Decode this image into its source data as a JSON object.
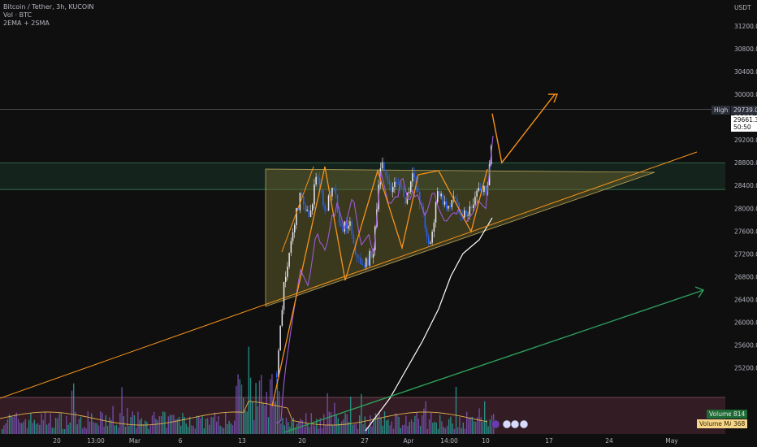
{
  "legend": {
    "symbol": "Bitcoin / Tether, 3h, KUCOIN",
    "volume": "Vol · BTC",
    "ma": "2EMA + 2SMA"
  },
  "price_axis": {
    "currency": "USDT",
    "ticks": [
      "31200.0",
      "30800.0",
      "30400.0",
      "30000.0",
      "29600.0",
      "29200.0",
      "28800.0",
      "28400.0",
      "28000.0",
      "27600.0",
      "27200.0",
      "26800.0",
      "26400.0",
      "26000.0",
      "25600.0",
      "25200.0"
    ],
    "high_label": "High",
    "high_value": "29739.0",
    "last_price": "29661.3",
    "countdown": "50:50"
  },
  "time_axis": {
    "ticks": [
      "20",
      "13:00",
      "Mar",
      "6",
      "13",
      "20",
      "27",
      "Apr",
      "14:00",
      "10",
      "17",
      "24",
      "May"
    ]
  },
  "volume_tags": {
    "volume_label": "Volume",
    "volume_value": "814",
    "ma_label": "Volume MA",
    "ma_value": "368"
  },
  "colors": {
    "background": "#0f0f0f",
    "candle_up": "#e8e8f0",
    "candle_down": "#2962ff",
    "orange": "#f7931a",
    "green_line": "#2e9e5b",
    "ema": "#9c5bd6",
    "sma": "#ffffff",
    "triangle_fill": "#6e6a2e",
    "zone_fill": "#1c3b2e"
  },
  "chart_data": {
    "type": "candlestick",
    "symbol": "BTC/USDT",
    "timeframe": "3h",
    "ylim": [
      25000,
      31500
    ],
    "high": 29739.0,
    "last": 29661.3,
    "price_path": [
      {
        "x": "Mar 15",
        "y": 25100
      },
      {
        "x": "Mar 16",
        "y": 26800
      },
      {
        "x": "Mar 17",
        "y": 27600
      },
      {
        "x": "Mar 18",
        "y": 28300
      },
      {
        "x": "Mar 19",
        "y": 27800
      },
      {
        "x": "Mar 20",
        "y": 28600
      },
      {
        "x": "Mar 21",
        "y": 27900
      },
      {
        "x": "Mar 22",
        "y": 28500
      },
      {
        "x": "Mar 23",
        "y": 27600
      },
      {
        "x": "Mar 24",
        "y": 27800
      },
      {
        "x": "Mar 25",
        "y": 27100
      },
      {
        "x": "Mar 26",
        "y": 27000
      },
      {
        "x": "Mar 27",
        "y": 27300
      },
      {
        "x": "Mar 28",
        "y": 28900
      },
      {
        "x": "Mar 29",
        "y": 28300
      },
      {
        "x": "Mar 30",
        "y": 28500
      },
      {
        "x": "Mar 31",
        "y": 28100
      },
      {
        "x": "Apr 1",
        "y": 28600
      },
      {
        "x": "Apr 2",
        "y": 28000
      },
      {
        "x": "Apr 3",
        "y": 27300
      },
      {
        "x": "Apr 4",
        "y": 28300
      },
      {
        "x": "Apr 5",
        "y": 28000
      },
      {
        "x": "Apr 6",
        "y": 28200
      },
      {
        "x": "Apr 7",
        "y": 27900
      },
      {
        "x": "Apr 8",
        "y": 27950
      },
      {
        "x": "Apr 9",
        "y": 28400
      },
      {
        "x": "Apr 10",
        "y": 28250
      },
      {
        "x": "Apr 11",
        "y": 29661.3
      }
    ],
    "resistance_zone": [
      28330,
      28800
    ],
    "projection": [
      {
        "x": "Apr 11",
        "y": 29661.3
      },
      {
        "x": "Apr 12",
        "y": 28800
      },
      {
        "x": "Apr 15",
        "y": 30000
      }
    ]
  }
}
